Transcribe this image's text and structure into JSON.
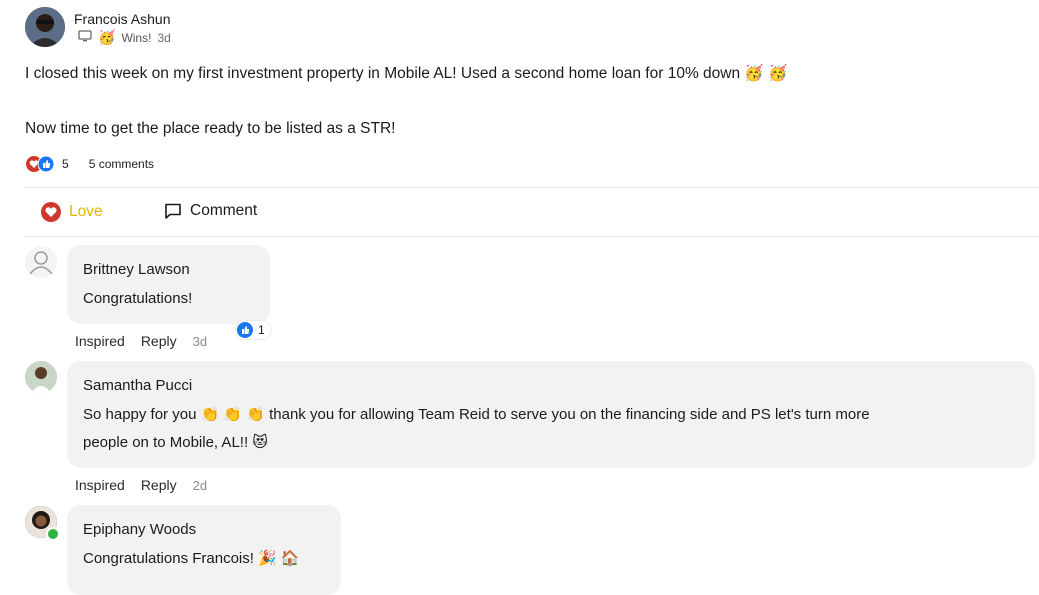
{
  "post": {
    "author": "Francois Ashun",
    "category": "Wins!",
    "time": "3d",
    "line1": "I closed this week on my first investment property in Mobile AL! Used a second home loan for 10% down 🥳 🥳",
    "line2": "Now time to get the place ready to be listed as a STR!",
    "reaction_count": "5",
    "comments_label": "5 comments"
  },
  "actions": {
    "love_label": "Love",
    "comment_label": "Comment"
  },
  "comments": [
    {
      "name": "Brittney Lawson",
      "text": "Congratulations!",
      "reaction_label": "Inspired",
      "reply_label": "Reply",
      "time": "3d",
      "likes": "1"
    },
    {
      "name": "Samantha Pucci",
      "text_line1": "So happy for you 👏 👏 👏 thank you for allowing Team Reid to serve you on the financing side and PS let's turn more",
      "text_line2": "people on to Mobile, AL!! 😻",
      "reaction_label": "Inspired",
      "reply_label": "Reply",
      "time": "2d"
    },
    {
      "name": "Epiphany Woods",
      "text": "Congratulations Francois! 🎉 🏠"
    }
  ],
  "colors": {
    "love": "#d0372b",
    "love_label": "#e2b400",
    "like_blue": "#1877f2",
    "online_green": "#2fb344"
  }
}
